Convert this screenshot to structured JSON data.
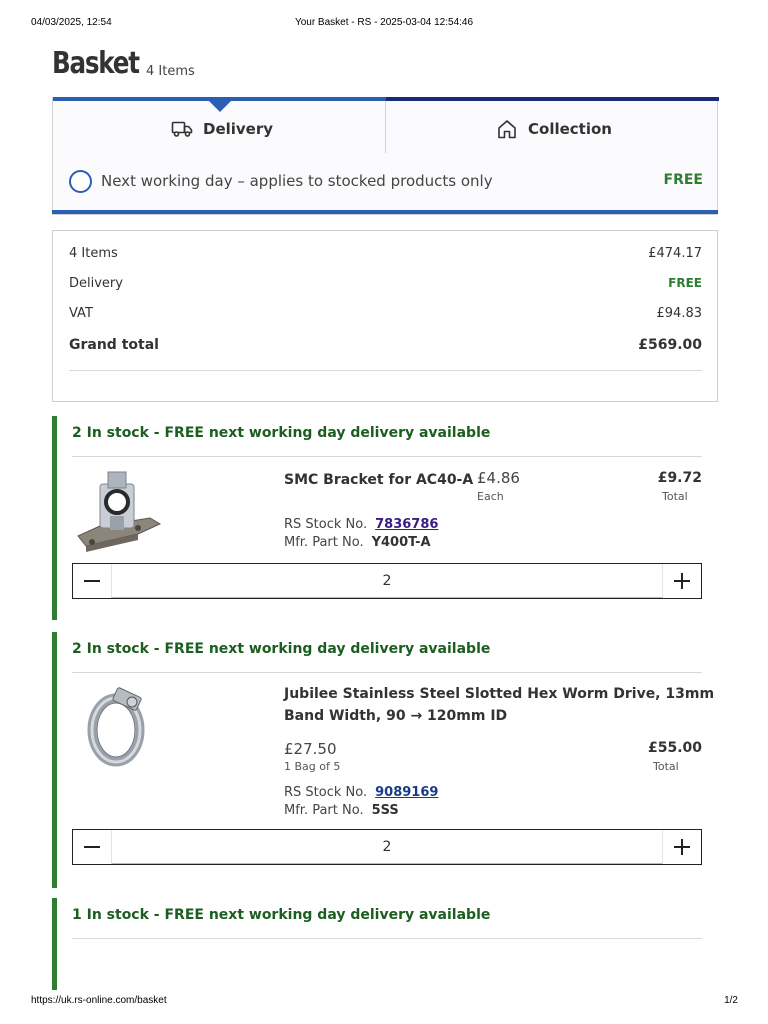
{
  "print": {
    "date": "04/03/2025, 12:54",
    "title": "Your Basket - RS - 2025-03-04 12:54:46",
    "url": "https://uk.rs-online.com/basket",
    "page": "1/2"
  },
  "basket": {
    "title": "Basket",
    "count": "4 Items"
  },
  "delivery": {
    "tabs": [
      {
        "label": "Delivery",
        "icon": "truck-icon",
        "selected": true
      },
      {
        "label": "Collection",
        "icon": "house-icon",
        "selected": false
      }
    ],
    "option_label": "Next working day – applies to stocked products only",
    "option_price": "FREE",
    "accent_color": "#2b5fb4"
  },
  "summary": {
    "items_label": "4 Items",
    "items_value": "£474.17",
    "delivery_label": "Delivery",
    "delivery_value": "FREE",
    "vat_label": "VAT",
    "vat_value": "£94.83",
    "grand_label": "Grand total",
    "grand_value": "£569.00"
  },
  "groups": [
    {
      "heading": "2 In stock - FREE next working day delivery available",
      "product": {
        "name": "SMC Bracket for AC40-A",
        "unit_price": "£4.86",
        "unit_label": "Each",
        "total_price": "£9.72",
        "total_label": "Total",
        "stock_label": "RS Stock No.",
        "stock_no": "7836786",
        "mfr_label": "Mfr. Part No.",
        "mfr_no": "Y400T-A",
        "quantity": "2",
        "image_icon": "bracket-image"
      }
    },
    {
      "heading": "2 In stock - FREE next working day delivery available",
      "product": {
        "name_line1": "Jubilee Stainless Steel Slotted Hex Worm Drive, 13mm",
        "name_line2": "Band Width, 90 → 120mm ID",
        "unit_price": "£27.50",
        "unit_label": "1 Bag of 5",
        "total_price": "£55.00",
        "total_label": "Total",
        "stock_label": "RS Stock No.",
        "stock_no": "9089169",
        "mfr_label": "Mfr. Part No.",
        "mfr_no": "5SS",
        "quantity": "2",
        "image_icon": "hose-clamp-image"
      }
    },
    {
      "heading": "1 In stock - FREE next working day delivery available"
    }
  ],
  "colors": {
    "stock_green": "#2e7d32",
    "heading_green": "#1b5e20",
    "navy": "#1a2a7a"
  }
}
